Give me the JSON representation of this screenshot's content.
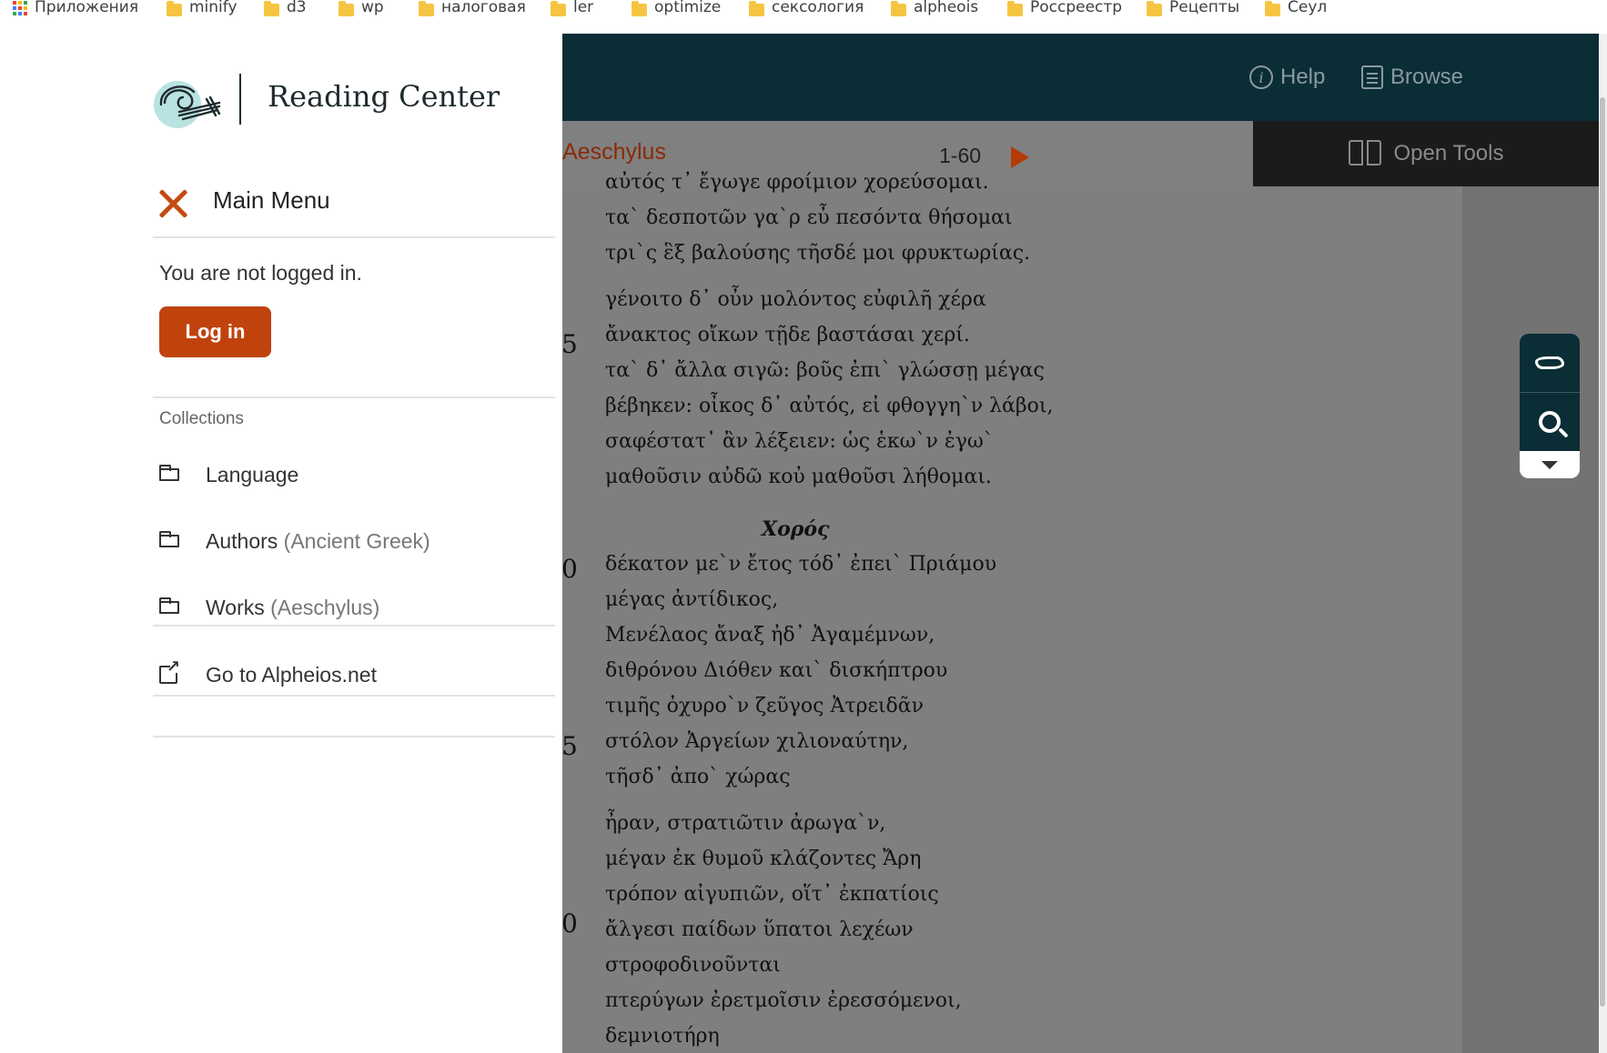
{
  "bookmarks": [
    {
      "label": "Приложения",
      "icon": "apps-grid-icon"
    },
    {
      "label": "minify",
      "icon": "folder-icon"
    },
    {
      "label": "d3",
      "icon": "folder-icon"
    },
    {
      "label": "wp",
      "icon": "folder-icon"
    },
    {
      "label": "налоговая",
      "icon": "folder-icon"
    },
    {
      "label": "ler",
      "icon": "folder-icon"
    },
    {
      "label": "optimize",
      "icon": "folder-icon"
    },
    {
      "label": "сексология",
      "icon": "folder-icon"
    },
    {
      "label": "alpheois",
      "icon": "folder-icon"
    },
    {
      "label": "Россреестр",
      "icon": "folder-icon"
    },
    {
      "label": "Рецепты",
      "icon": "folder-icon"
    },
    {
      "label": "Сеул",
      "icon": "folder-icon"
    }
  ],
  "topbar": {
    "help": "Help",
    "browse": "Browse",
    "help_icon": "info-icon",
    "browse_icon": "list-icon"
  },
  "reader": {
    "author": "Aeschylus",
    "range": "1-60",
    "open_tools": "Open Tools",
    "line_numbers": [
      "5",
      "0",
      "5",
      "0"
    ],
    "speaker": "Χορός",
    "lines": [
      "αὐτός τ᾽ ἔγωγε φροίμιον χορεύσομαι.",
      "τα` δεσποτῶν γα`ρ εὖ πεσόντα θήσομαι",
      "τρι`ς ἓξ βαλούσης τῆσδέ μοι φρυκτωρίας.",
      "γένοιτο δ᾽ οὖν μολόντος εὐφιλῆ χέρα",
      "ἄνακτος οἴκων τῇδε βαστάσαι χερί.",
      "τα` δ᾽ ἄλλα σιγῶ: βοῦς ἐπι` γλώσσῃ μέγας",
      "βέβηκεν: οἶκος δ᾽ αὐτός, εἰ φθογγη`ν λάβοι,",
      "σαφέστατ᾽ ἂν λέξειεν: ὡς ἑκω`ν ἐγω`",
      "μαθοῦσιν αὐδῶ κοὐ μαθοῦσι λήθομαι.",
      "δέκατον με`ν ἔτος τόδ᾽ ἐπει` Πριάμου",
      "μέγας ἀντίδικος,",
      "Μενέλαος ἄναξ ἠδ᾽ Ἀγαμέμνων,",
      "διθρόνου Διόθεν και` δισκήπτρου",
      "τιμῆς ὀχυρο`ν ζεῦγος Ἀτρειδᾶν",
      "στόλον Ἀργείων χιλιοναύτην,",
      "τῆσδ᾽ ἀπο` χώρας",
      "ἦραν, στρατιῶτιν ἀρωγα`ν,",
      "μέγαν ἐκ θυμοῦ κλάζοντες Ἄρη",
      "τρόπον αἰγυπιῶν, οἵτ᾽ ἐκπατίοις",
      "ἄλγεσι παίδων ὕπατοι λεχέων",
      "στροφοδινοῦνται",
      "πτερύγων ἐρετμοῖσιν ἐρεσσόμενοι,",
      "δεμνιοτήρη"
    ]
  },
  "float_tools": {
    "top_icon": "alpheios-logo-icon",
    "search_icon": "search-icon",
    "expand_icon": "caret-down-icon"
  },
  "menu": {
    "brand": "Reading Center",
    "title": "Main Menu",
    "not_logged": "You are not logged in.",
    "login": "Log in",
    "collections_label": "Collections",
    "items": [
      {
        "label": "Language",
        "sub": "",
        "icon": "folder-icon"
      },
      {
        "label": "Authors",
        "sub": "(Ancient Greek)",
        "icon": "folder-icon"
      },
      {
        "label": "Works",
        "sub": "(Aeschylus)",
        "icon": "folder-icon"
      },
      {
        "label": "Go to Alpheios.net",
        "sub": "",
        "icon": "external-link-icon"
      }
    ],
    "accent_color": "#c0430d",
    "brand_color": "#0b2d36"
  }
}
